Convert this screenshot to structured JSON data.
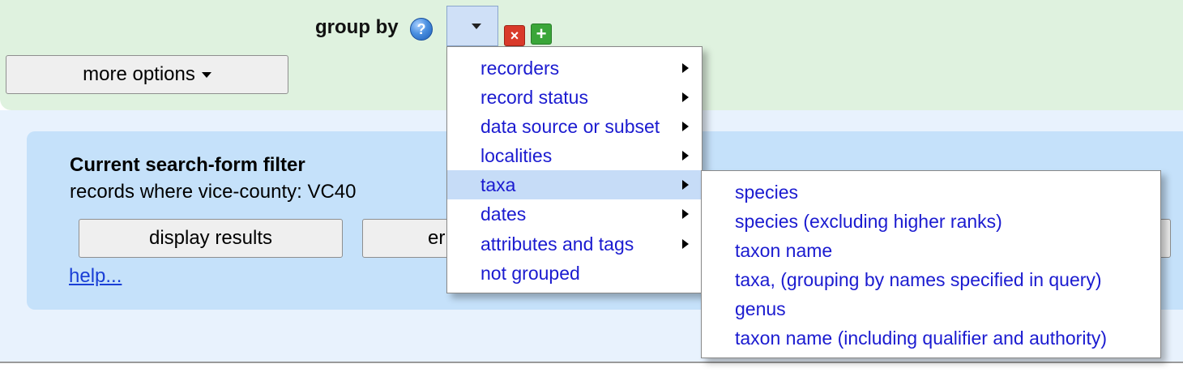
{
  "group_by": {
    "label": "group by",
    "help_icon": "help-icon",
    "selected_value": "",
    "remove_icon": "remove-icon",
    "add_icon": "add-icon"
  },
  "more_options": {
    "label": "more options"
  },
  "filter": {
    "title": "Current search-form filter",
    "description": "records where vice-county: VC40",
    "display_button": "display results",
    "second_button": "er",
    "third_button": "",
    "help_link": "help..."
  },
  "menu": {
    "items": [
      {
        "label": "recorders",
        "has_submenu": true
      },
      {
        "label": "record status",
        "has_submenu": true
      },
      {
        "label": "data source or subset",
        "has_submenu": true
      },
      {
        "label": "localities",
        "has_submenu": true
      },
      {
        "label": "taxa",
        "has_submenu": true,
        "active": true
      },
      {
        "label": "dates",
        "has_submenu": true
      },
      {
        "label": "attributes and tags",
        "has_submenu": true
      },
      {
        "label": "not grouped",
        "has_submenu": false
      }
    ],
    "highlight_color": "#c6dcf7",
    "text_color": "#1b1bd0"
  },
  "submenu": {
    "items": [
      "species",
      "species (excluding higher ranks)",
      "taxon name",
      "taxa, (grouping by names specified in query)",
      "genus",
      "taxon name (including qualifier and authority)"
    ]
  },
  "colors": {
    "top_panel": "#dff2df",
    "filter_panel": "#c5e1fa",
    "link": "#1a3fd6"
  }
}
